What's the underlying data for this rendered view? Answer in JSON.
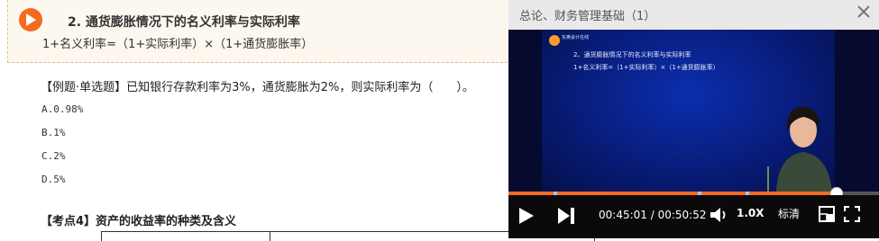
{
  "tip": {
    "title": "2. 通货膨胀情况下的名义利率与实际利率",
    "formula": "1+名义利率=（1+实际利率）×（1+通货膨胀率）"
  },
  "question": {
    "text": "【例题·单选题】已知银行存款利率为3%，通货膨胀为2%，则实际利率为（　　）。",
    "options": [
      "A.0.98%",
      "B.1%",
      "C.2%",
      "D.5%"
    ]
  },
  "section": {
    "heading": "【考点4】资产的收益率的种类及含义"
  },
  "player": {
    "title": "总论、财务管理基础（1）",
    "slide": {
      "logo_text": "东奥会计在线",
      "line1": "2、通货膨胀情况下的名义利率与实际利率",
      "line2": "1+名义利率=（1+实际利率）×（1+通货膨胀率）"
    },
    "current_time": "00:45:01",
    "total_time": "00:50:52",
    "time_display": "00:45:01 / 00:50:52",
    "progress": 0.885,
    "speed": "1.0X",
    "quality": "标清",
    "colors": {
      "accent": "#f26b21",
      "video_bg": "#050a2e",
      "controls_bg": "#0a0a0a"
    }
  }
}
